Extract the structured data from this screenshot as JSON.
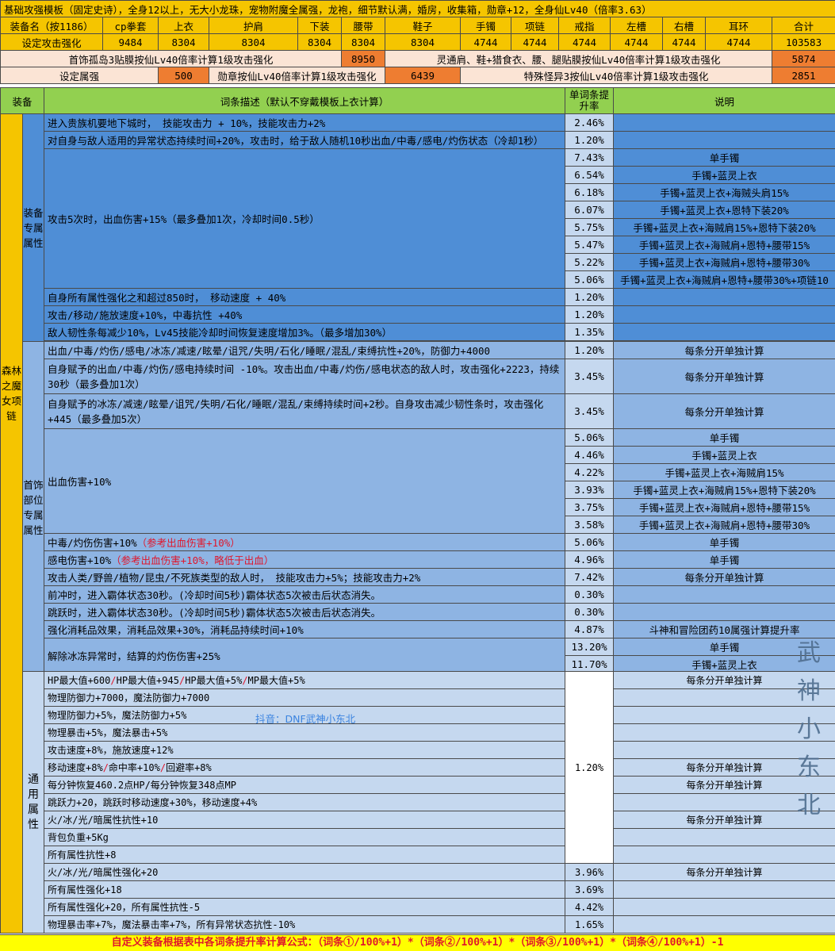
{
  "header": {
    "title": "基础攻强模板（固定史诗），全身12以上，无大小龙珠，宠物附魔全属强，龙袍，细节默认满，婚房，收集箱，勋章+12，全身仙Lv40（倍率3.63）",
    "columns": [
      "装备名（按1186）",
      "cp拳套",
      "上衣",
      "护肩",
      "下装",
      "腰带",
      "鞋子",
      "手镯",
      "项链",
      "戒指",
      "左槽",
      "右槽",
      "耳环",
      "合计"
    ],
    "values_label": "设定攻击强化",
    "values": [
      "9484",
      "8304",
      "8304",
      "8304",
      "8304",
      "8304",
      "4744",
      "4744",
      "4744",
      "4744",
      "4744",
      "4744",
      "103583"
    ],
    "row3_left_label": "首饰孤岛3贴膜按仙Lv40倍率计算1级攻击强化",
    "row3_left_value": "8950",
    "row3_right_label": "灵通肩、鞋+猎食衣、腰、腿贴膜按仙Lv40倍率计算1级攻击强化",
    "row3_right_value": "5874",
    "row4_a_label": "设定属强",
    "row4_a_value": "500",
    "row4_b_label": "勋章按仙Lv40倍率计算1级攻击强化",
    "row4_b_value": "6439",
    "row4_c_label": "特殊怪异3按仙Lv40倍率计算1级攻击强化",
    "row4_c_value": "2851"
  },
  "table_head": {
    "col_equip": "装备",
    "col_desc": "词条描述（默认不穿戴模板上衣计算）",
    "col_rate": "单词条提升率",
    "col_note": "说明"
  },
  "equipment_name": "森林之魔女项链",
  "groups": {
    "g1": "装备专属属性",
    "g2": "首饰部位专属属性",
    "g3": "通用属性"
  },
  "rows": {
    "r1_desc": "进入贵族机要地下城时， 技能攻击力 + 10%，技能攻击力+2%",
    "r1_rate": "2.46%",
    "r2_desc": "对自身与敌人适用的异常状态持续时间+20%，攻击时，给于敌人随机10秒出血/中毒/感电/灼伤状态（冷却1秒）",
    "r2_rate": "1.20%",
    "r3_desc": "攻击5次时，出血伤害+15%（最多叠加1次，冷却时间0.5秒）",
    "r3_sub": [
      {
        "rate": "7.43%",
        "note": "单手镯"
      },
      {
        "rate": "6.54%",
        "note": "手镯+蓝灵上衣"
      },
      {
        "rate": "6.18%",
        "note": "手镯+蓝灵上衣+海贼头肩15%"
      },
      {
        "rate": "6.07%",
        "note": "手镯+蓝灵上衣+恩特下装20%"
      },
      {
        "rate": "5.75%",
        "note": "手镯+蓝灵上衣+海贼肩15%+恩特下装20%"
      },
      {
        "rate": "5.47%",
        "note": "手镯+蓝灵上衣+海贼肩+恩特+腰带15%"
      },
      {
        "rate": "5.22%",
        "note": "手镯+蓝灵上衣+海贼肩+恩特+腰带30%"
      },
      {
        "rate": "5.06%",
        "note": "手镯+蓝灵上衣+海贼肩+恩特+腰带30%+项链10"
      }
    ],
    "r4_desc": "自身所有属性强化之和超过850时， 移动速度 + 40%",
    "r4_rate": "1.20%",
    "r5_desc": "攻击/移动/施放速度+10%，中毒抗性 +40%",
    "r5_rate": "1.20%",
    "r6_desc": "敌人韧性条每减少10%，Lv45技能冷却时间恢复速度增加3%。（最多增加30%）",
    "r6_rate": "1.35%",
    "a1_desc": "出血/中毒/灼伤/感电/冰冻/减速/眩晕/诅咒/失明/石化/睡眠/混乱/束缚抗性+20%，防御力+4000",
    "a1_rate": "1.20%",
    "a1_note": "每条分开单独计算",
    "a2_desc": "自身赋予的出血/中毒/灼伤/感电持续时间 -10%。攻击出血/中毒/灼伤/感电状态的敌人时，攻击强化+2223，持续30秒（最多叠加1次）",
    "a2_rate": "3.45%",
    "a2_note": "每条分开单独计算",
    "a3_desc": "自身赋予的冰冻/减速/眩晕/诅咒/失明/石化/睡眠/混乱/束缚持续时间+2秒。自身攻击减少韧性条时，攻击强化+445（最多叠加5次）",
    "a3_rate": "3.45%",
    "a3_note": "每条分开单独计算",
    "a4_desc": "出血伤害+10%",
    "a4_sub": [
      {
        "rate": "5.06%",
        "note": "单手镯"
      },
      {
        "rate": "4.46%",
        "note": "手镯+蓝灵上衣"
      },
      {
        "rate": "4.22%",
        "note": "手镯+蓝灵上衣+海贼肩15%"
      },
      {
        "rate": "3.93%",
        "note": "手镯+蓝灵上衣+海贼肩15%+恩特下装20%"
      },
      {
        "rate": "3.75%",
        "note": "手镯+蓝灵上衣+海贼肩+恩特+腰带15%"
      },
      {
        "rate": "3.58%",
        "note": "手镯+蓝灵上衣+海贼肩+恩特+腰带30%"
      }
    ],
    "a5_desc": "中毒/灼伤伤害+10%",
    "a5_red": "（参考出血伤害+10%）",
    "a5_rate": "5.06%",
    "a5_note": "单手镯",
    "a6_desc": "感电伤害+10%",
    "a6_red": "（参考出血伤害+10%，略低于出血）",
    "a6_rate": "4.96%",
    "a6_note": "单手镯",
    "a7_desc": "攻击人类/野兽/植物/昆虫/不死族类型的敌人时， 技能攻击力+5%；技能攻击力+2%",
    "a7_rate": "7.42%",
    "a7_note": "每条分开单独计算",
    "a8_desc": "前冲时，进入霸体状态30秒。(冷却时间5秒)霸体状态5次被击后状态消失。",
    "a8_rate": "0.30%",
    "a9_desc": "跳跃时，进入霸体状态30秒。(冷却时间5秒)霸体状态5次被击后状态消失。",
    "a9_rate": "0.30%",
    "a10_desc": "强化消耗品效果，消耗品效果+30%，消耗品持续时间+10%",
    "a10_rate": "4.87%",
    "a10_note": "斗神和冒险团药10属强计算提升率",
    "a11_desc": "解除冰冻异常时，结算的灼伤伤害+25%",
    "a11_sub": [
      {
        "rate": "13.20%",
        "note": "单手镯"
      },
      {
        "rate": "11.70%",
        "note": "手镯+蓝灵上衣"
      }
    ],
    "c1_desc_a": "HP最大值+600",
    "c1_desc_b": "HP最大值+945",
    "c1_desc_c": "HP最大值+5%",
    "c1_desc_d": "MP最大值+5%",
    "c1_note": "每条分开单独计算",
    "c2_desc": "物理防御力+7000，魔法防御力+7000",
    "c3_desc": "物理防御力+5%，魔法防御力+5%",
    "c4_desc": "物理暴击+5%，魔法暴击+5%",
    "c5_desc": "攻击速度+8%，施放速度+12%",
    "c6_desc_a": "移动速度+8%",
    "c6_desc_b": "命中率+10%",
    "c6_desc_c": "回避率+8%",
    "c6_note": "每条分开单独计算",
    "c7_desc": "每分钟恢复460.2点HP/每分钟恢复348点MP",
    "c7_note": "每条分开单独计算",
    "c8_desc": "跳跃力+20，跳跃时移动速度+30%，移动速度+4%",
    "c9_desc": "火/冰/光/暗属性抗性+10",
    "c9_note": "每条分开单独计算",
    "c10_desc": "背包负重+5Kg",
    "c11_desc": "所有属性抗性+8",
    "c_shared_rate": "1.20%",
    "c12_desc": "火/冰/光/暗属性强化+20",
    "c12_rate": "3.96%",
    "c12_note": "每条分开单独计算",
    "c13_desc": "所有属性强化+18",
    "c13_rate": "3.69%",
    "c14_desc": "所有属性强化+20，所有属性抗性-5",
    "c14_rate": "4.42%",
    "c15_desc": "物理暴击率+7%，魔法暴击率+7%，所有异常状态抗性-10%",
    "c15_rate": "1.65%"
  },
  "douyin_text": "抖音：DNF武神小东北",
  "watermark_chars": [
    "武",
    "神",
    "小",
    "东",
    "北"
  ],
  "footer": "自定义装备根据表中各词条提升率计算公式：（词条①/100%+1）*（词条②/100%+1）*（词条③/100%+1）*（词条④/100%+1）-1",
  "colors": {
    "gold": "#f5c500",
    "orange": "#ee7d31",
    "green": "#92d050",
    "blue_dark": "#4f8ed6",
    "blue_mid": "#8eb4e3",
    "blue_light": "#c5d8ef",
    "red_text": "#e0162b"
  }
}
